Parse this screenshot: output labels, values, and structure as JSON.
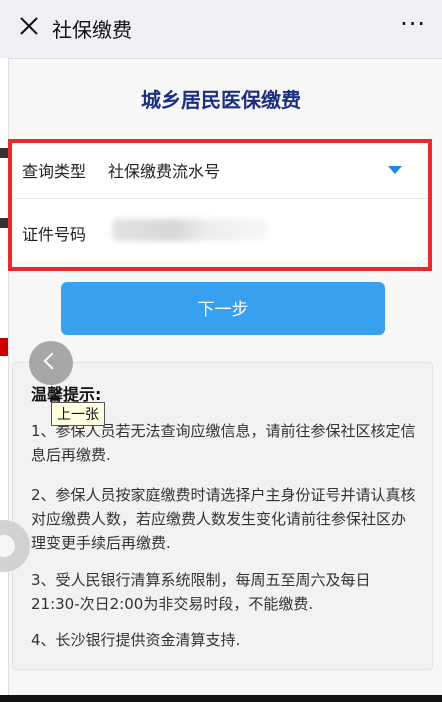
{
  "topbar": {
    "title": "社保缴费",
    "more": "···"
  },
  "page": {
    "title": "城乡居民医保缴费"
  },
  "form": {
    "query_type_label": "查询类型",
    "query_type_value": "社保缴费流水号",
    "id_label": "证件号码",
    "id_value": ""
  },
  "actions": {
    "next_label": "下一步"
  },
  "notice": {
    "title": "温馨提示:",
    "items": [
      "1、参保人员若无法查询应缴信息，请前往参保社区核定信息后再缴费.",
      "2、参保人员按家庭缴费时请选择户主身份证号并请认真核对应缴费人数，若应缴费人数发生变化请前往参保社区办理变更手续后再缴费.",
      "3、受人民银行清算系统限制，每周五至周六及每日21:30-次日2:00为非交易时段，不能缴费.",
      "4、长沙银行提供资金清算支持."
    ]
  },
  "overlay": {
    "tooltip": "上一张"
  },
  "icons": {
    "close": "close-icon",
    "more": "more-icon",
    "dropdown": "chevron-down-icon",
    "prev": "chevron-left-icon"
  },
  "colors": {
    "title": "#1c2f80",
    "button": "#37a0ef",
    "highlight": "#ea2b2b",
    "caret": "#1e88e5"
  }
}
